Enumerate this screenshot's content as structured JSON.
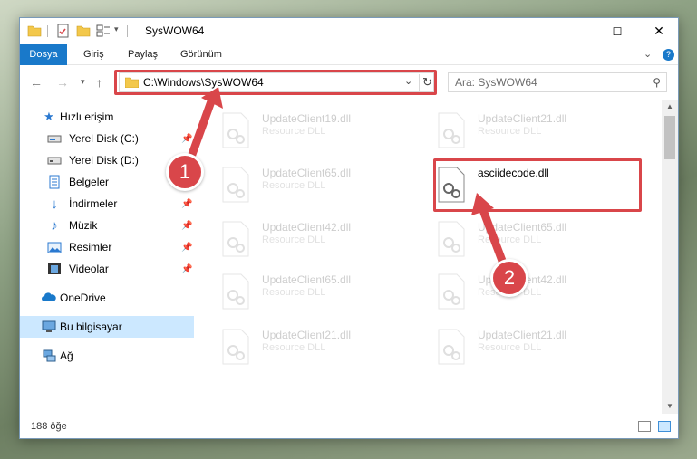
{
  "window": {
    "title": "SysWOW64",
    "controls": {
      "minimize": "–",
      "maximize": "☐",
      "close": "✕"
    }
  },
  "ribbon": {
    "tabs": [
      "Dosya",
      "Giriş",
      "Paylaş",
      "Görünüm"
    ],
    "expand_icon": "⌄",
    "help_icon": "?"
  },
  "address": {
    "path": "C:\\Windows\\SysWOW64",
    "search_placeholder": "Ara: SysWOW64"
  },
  "nav": {
    "items": [
      {
        "label": "Hızlı erişim",
        "icon": "star-icon",
        "pinned": false
      },
      {
        "label": "Yerel Disk (C:)",
        "icon": "drive-icon",
        "pinned": true
      },
      {
        "label": "Yerel Disk (D:)",
        "icon": "drive-icon",
        "pinned": true
      },
      {
        "label": "Belgeler",
        "icon": "documents-icon",
        "pinned": true
      },
      {
        "label": "İndirmeler",
        "icon": "download-icon",
        "pinned": true
      },
      {
        "label": "Müzik",
        "icon": "music-icon",
        "pinned": true
      },
      {
        "label": "Resimler",
        "icon": "pictures-icon",
        "pinned": true
      },
      {
        "label": "Videolar",
        "icon": "video-icon",
        "pinned": true
      },
      {
        "label": "OneDrive",
        "icon": "cloud-icon",
        "pinned": false
      },
      {
        "label": "Bu bilgisayar",
        "icon": "computer-icon",
        "pinned": false,
        "selected": true
      },
      {
        "label": "Ağ",
        "icon": "network-icon",
        "pinned": false
      }
    ]
  },
  "files": [
    {
      "name": "UpdateClient19.dll",
      "type": "Resource DLL",
      "faded": true
    },
    {
      "name": "UpdateClient21.dll",
      "type": "Resource DLL",
      "faded": true
    },
    {
      "name": "UpdateClient65.dll",
      "type": "Resource DLL",
      "faded": true
    },
    {
      "name": "asciidecode.dll",
      "type": "",
      "faded": false
    },
    {
      "name": "UpdateClient42.dll",
      "type": "Resource DLL",
      "faded": true
    },
    {
      "name": "UpdateClient65.dll",
      "type": "Resource DLL",
      "faded": true
    },
    {
      "name": "UpdateClient65.dll",
      "type": "Resource DLL",
      "faded": true
    },
    {
      "name": "UpdateClient42.dll",
      "type": "Resource DLL",
      "faded": true
    },
    {
      "name": "UpdateClient21.dll",
      "type": "Resource DLL",
      "faded": true
    },
    {
      "name": "UpdateClient21.dll",
      "type": "Resource DLL",
      "faded": true
    }
  ],
  "status": {
    "item_count": "188 öğe"
  },
  "callouts": [
    "1",
    "2"
  ],
  "colors": {
    "accent": "#1979ca",
    "highlight": "#d9464a",
    "selected_bg": "#cce8ff"
  }
}
